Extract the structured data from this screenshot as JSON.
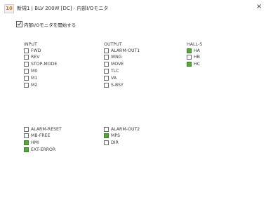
{
  "window": {
    "icon_text": "10",
    "title": "新規1 | BLV 200W [DC] - 内部I/Oモニタ",
    "close_glyph": "×"
  },
  "monitor_enable": {
    "label": "内部I/Oモニタを開始する",
    "checked": true
  },
  "colors": {
    "active": "#5aa63c",
    "inactive": "#ffffff"
  },
  "input": {
    "title": "INPUT",
    "signals": [
      {
        "label": "FWD",
        "active": false
      },
      {
        "label": "REV",
        "active": false
      },
      {
        "label": "STOP-MODE",
        "active": false
      },
      {
        "label": "M0",
        "active": false
      },
      {
        "label": "M1",
        "active": false
      },
      {
        "label": "M2",
        "active": false
      }
    ],
    "signals2": [
      {
        "label": "ALARM-RESET",
        "active": false
      },
      {
        "label": "MB-FREE",
        "active": false
      },
      {
        "label": "HMI",
        "active": true
      },
      {
        "label": "EXT-ERROR",
        "active": true
      }
    ]
  },
  "output": {
    "title": "OUTPUT",
    "signals": [
      {
        "label": "ALARM-OUT1",
        "active": false
      },
      {
        "label": "WNG",
        "active": false
      },
      {
        "label": "MOVE",
        "active": false
      },
      {
        "label": "TLC",
        "active": false
      },
      {
        "label": "VA",
        "active": false
      },
      {
        "label": "S-BSY",
        "active": false
      }
    ],
    "signals2": [
      {
        "label": "ALARM-OUT2",
        "active": false
      },
      {
        "label": "MPS",
        "active": true
      },
      {
        "label": "DIR",
        "active": false
      }
    ]
  },
  "hall": {
    "title": "HALL-S",
    "signals": [
      {
        "label": "HA",
        "active": true
      },
      {
        "label": "HB",
        "active": false
      },
      {
        "label": "HC",
        "active": true
      }
    ]
  }
}
